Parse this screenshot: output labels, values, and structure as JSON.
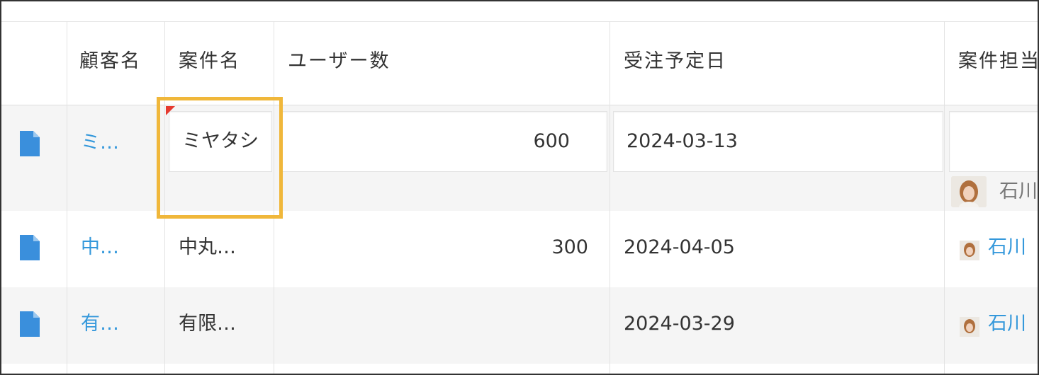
{
  "columns": [
    "顧客名",
    "案件名",
    "ユーザー数",
    "受注予定日",
    "案件担当"
  ],
  "rows": [
    {
      "customer": "ミ…",
      "project": "ミヤタシ",
      "users": "600",
      "date": "2024-03-13",
      "owner": "石川"
    },
    {
      "customer": "中…",
      "project": "中丸…",
      "users": "300",
      "date": "2024-04-05",
      "owner": "石川"
    },
    {
      "customer": "有…",
      "project": "有限…",
      "users": "",
      "date": "2024-03-29",
      "owner": "石川"
    }
  ],
  "icons": {
    "row_icon": "document-icon",
    "owner_icon": "avatar"
  },
  "colors": {
    "link": "#3498db",
    "focus_border": "#f0b73a",
    "error_marker": "#e63a2f",
    "alt_row": "#f5f5f5",
    "icon": "#3a8fdc"
  }
}
